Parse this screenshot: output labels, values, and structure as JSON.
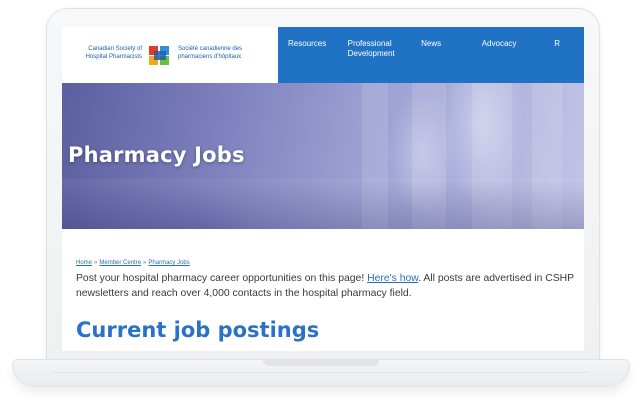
{
  "logo": {
    "en_line1": "Canadian Society of",
    "en_line2": "Hospital Pharmacists",
    "fr_line1": "Société canadienne des",
    "fr_line2": "pharmaciens d'hôpitaux"
  },
  "nav": {
    "items": [
      {
        "line1": "Resources",
        "line2": ""
      },
      {
        "line1": "Professional",
        "line2": "Development"
      },
      {
        "line1": "News",
        "line2": ""
      },
      {
        "line1": "Advocacy",
        "line2": ""
      },
      {
        "line1": "R",
        "line2": ""
      }
    ]
  },
  "hero": {
    "title": "Pharmacy Jobs"
  },
  "breadcrumb": {
    "items": [
      "Home",
      "Member Centre",
      "Pharmacy Jobs"
    ],
    "separator": "»"
  },
  "intro": {
    "before_link": "Post your hospital pharmacy career opportunities on this page! ",
    "link": "Here's how",
    "after_link": ". All posts are advertised in CSHP newsletters and reach over 4,000 contacts in the hospital pharmacy field."
  },
  "section": {
    "title": "Current job postings"
  },
  "colors": {
    "nav_bg": "#2073c4",
    "link": "#2a6fb8",
    "heading": "#2a72c6"
  },
  "icons": {
    "logo_mark": "cshp-logo-icon"
  }
}
